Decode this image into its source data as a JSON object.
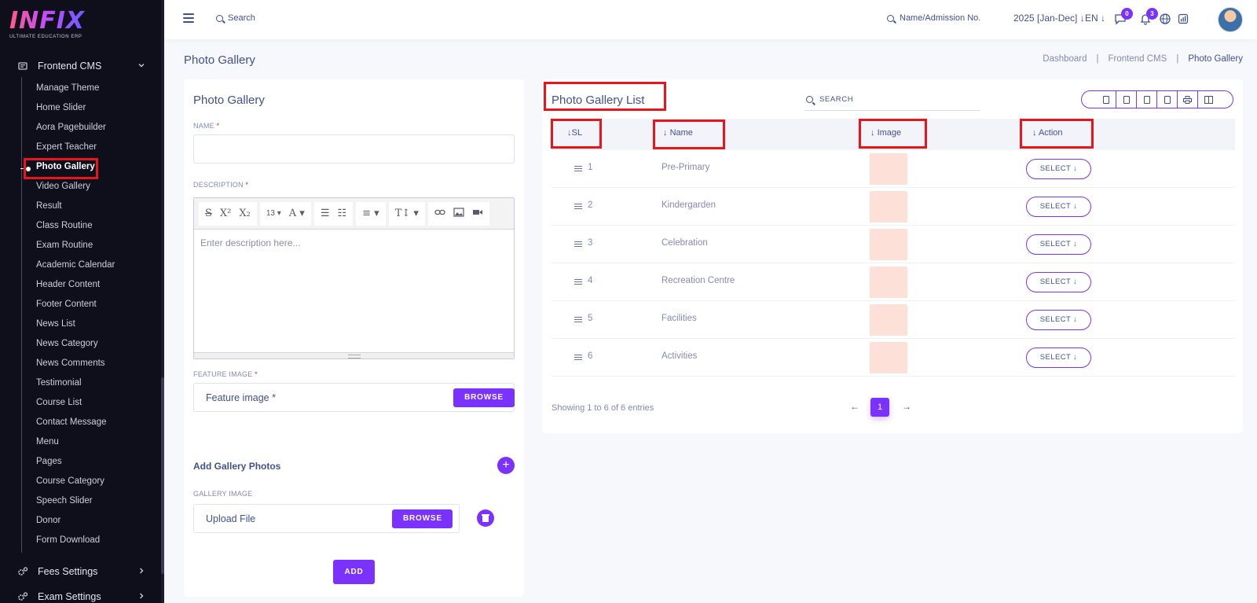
{
  "sidebar": {
    "logo_text": "INFIX",
    "logo_tagline": "ULTIMATE EDUCATION ERP",
    "group_label": "Frontend CMS",
    "items": [
      {
        "label": "Manage Theme"
      },
      {
        "label": "Home Slider"
      },
      {
        "label": "Aora Pagebuilder"
      },
      {
        "label": "Expert Teacher"
      },
      {
        "label": "Photo Gallery"
      },
      {
        "label": "Video Gallery"
      },
      {
        "label": "Result"
      },
      {
        "label": "Class Routine"
      },
      {
        "label": "Exam Routine"
      },
      {
        "label": "Academic Calendar"
      },
      {
        "label": "Header Content"
      },
      {
        "label": "Footer Content"
      },
      {
        "label": "News List"
      },
      {
        "label": "News Category"
      },
      {
        "label": "News Comments"
      },
      {
        "label": "Testimonial"
      },
      {
        "label": "Course List"
      },
      {
        "label": "Contact Message"
      },
      {
        "label": "Menu"
      },
      {
        "label": "Pages"
      },
      {
        "label": "Course Category"
      },
      {
        "label": "Speech Slider"
      },
      {
        "label": "Donor"
      },
      {
        "label": "Form Download"
      }
    ],
    "group_fees": "Fees Settings",
    "group_exam": "Exam Settings"
  },
  "topbar": {
    "search_label": "Search",
    "admission_search": "Name/Admission No.",
    "year": "2025 [Jan-Dec]",
    "language": "EN",
    "messages_count": "0",
    "notifications_count": "3"
  },
  "page": {
    "title": "Photo Gallery",
    "breadcrumb": [
      "Dashboard",
      "Frontend CMS",
      "Photo Gallery"
    ]
  },
  "form": {
    "title": "Photo Gallery",
    "name_label": "NAME",
    "description_label": "DESCRIPTION",
    "description_placeholder": "Enter description here...",
    "font_size": "13",
    "feature_image_label": "FEATURE IMAGE",
    "feature_image_placeholder": "Feature image *",
    "browse_label": "BROWSE",
    "add_gallery_title": "Add Gallery Photos",
    "gallery_image_label": "GALLERY IMAGE",
    "upload_placeholder": "Upload File",
    "add_label": "ADD",
    "required_mark": "*"
  },
  "list": {
    "title": "Photo Gallery List",
    "search_label": "SEARCH",
    "columns": [
      "SL",
      "Name",
      "Image",
      "Action"
    ],
    "rows": [
      {
        "sl": "1",
        "name": "Pre-Primary",
        "action": "SELECT"
      },
      {
        "sl": "2",
        "name": "Kindergarden",
        "action": "SELECT"
      },
      {
        "sl": "3",
        "name": "Celebration",
        "action": "SELECT"
      },
      {
        "sl": "4",
        "name": "Recreation Centre",
        "action": "SELECT"
      },
      {
        "sl": "5",
        "name": "Facilities",
        "action": "SELECT"
      },
      {
        "sl": "6",
        "name": "Activities",
        "action": "SELECT"
      }
    ],
    "showing": "Showing 1 to 6 of 6 entries",
    "current_page": "1"
  },
  "colors": {
    "accent": "#7c32ff",
    "text": "#415094",
    "sidebar_bg": "#0f0f1c",
    "highlight": "#e8151b",
    "image_placeholder": "#fde1d8"
  }
}
